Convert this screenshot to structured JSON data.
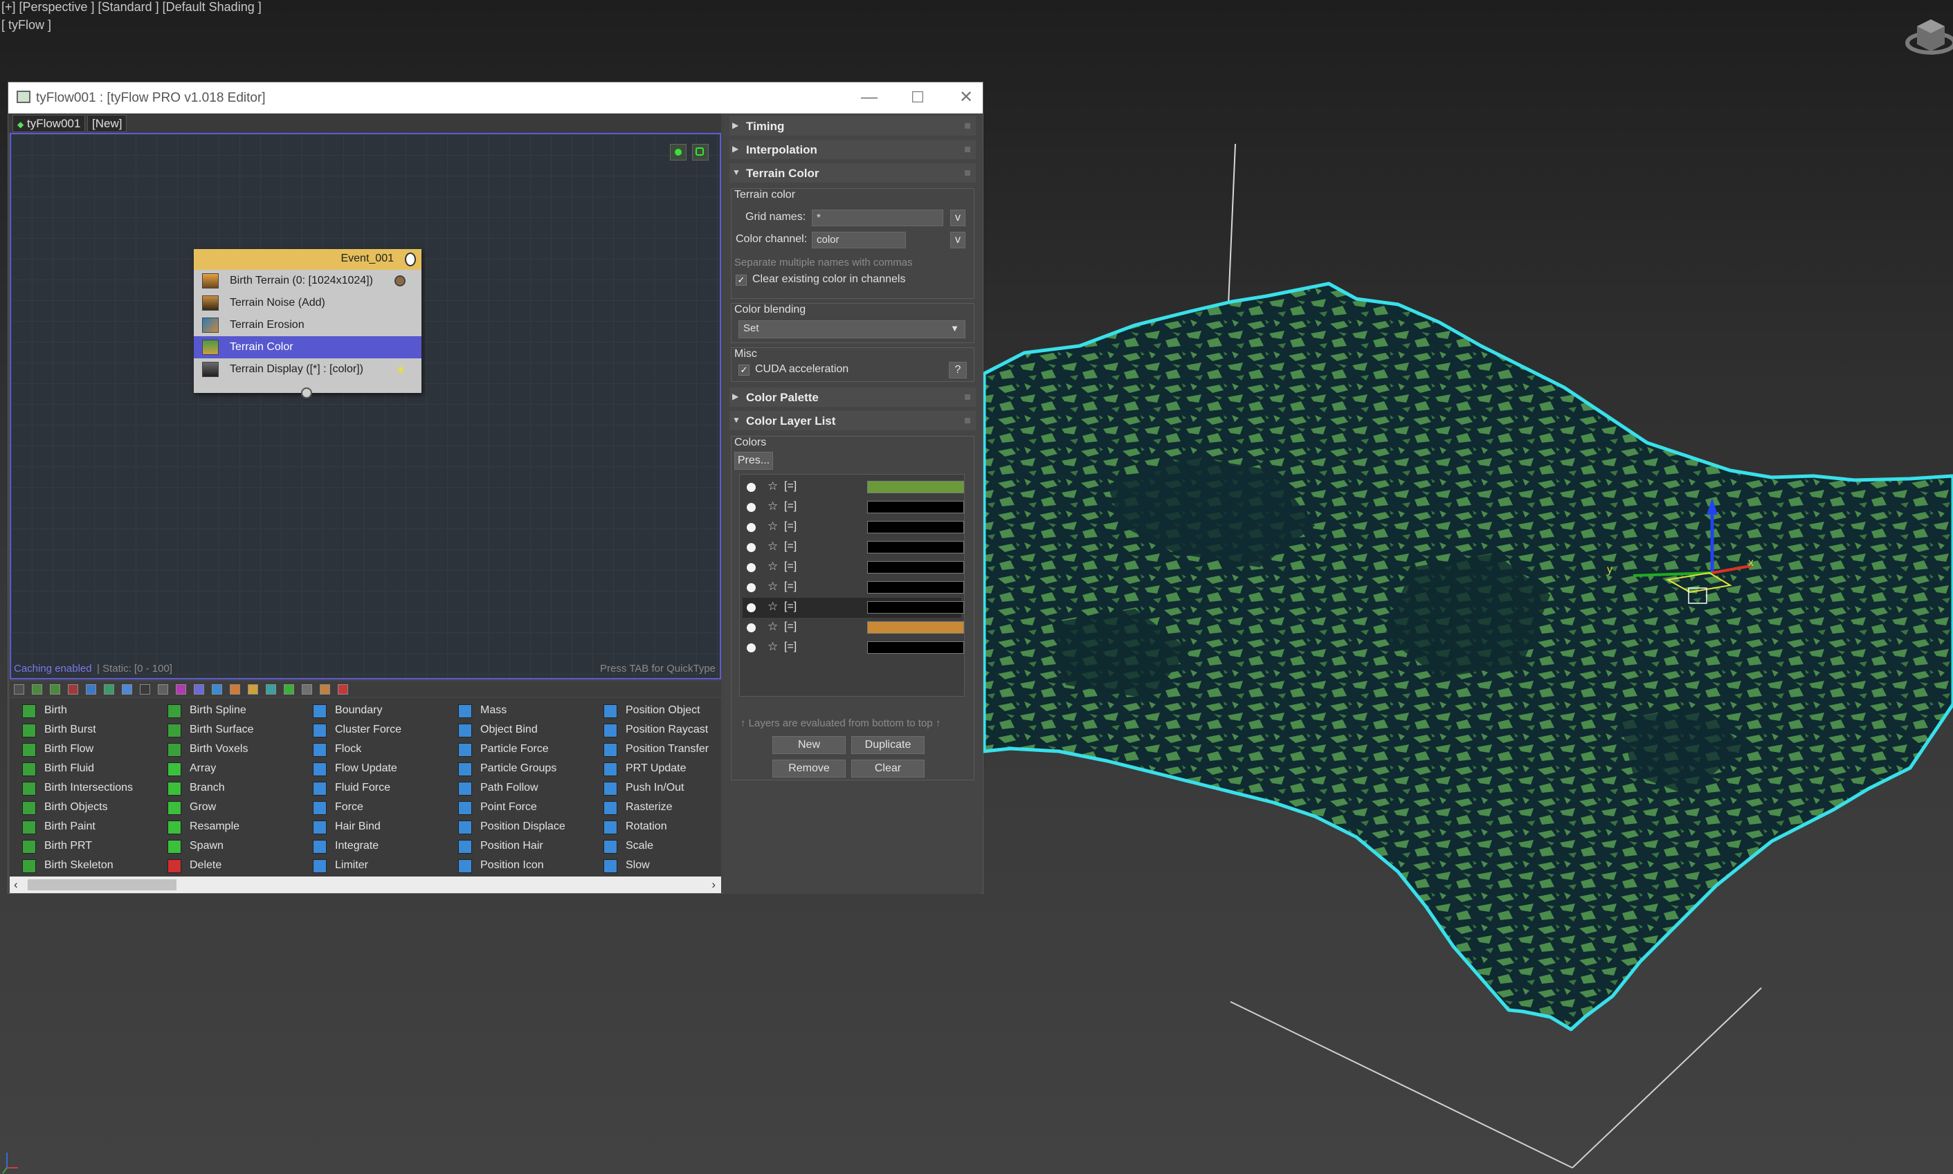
{
  "viewport": {
    "label_line1": "[+] [Perspective ] [Standard ] [Default Shading ]",
    "label_line2": "[ tyFlow ]"
  },
  "window": {
    "title": "tyFlow001 : [tyFlow PRO v1.018 Editor]",
    "controls": {
      "minimize": "—",
      "maximize": "☐",
      "close": "✕"
    },
    "tabs": [
      "tyFlow001",
      "[New]"
    ]
  },
  "graph": {
    "event": {
      "name": "Event_001",
      "operators": [
        {
          "label": "Birth Terrain (0: [1024x1024])",
          "selected": false
        },
        {
          "label": "Terrain Noise (Add)",
          "selected": false
        },
        {
          "label": "Terrain Erosion",
          "selected": false
        },
        {
          "label": "Terrain Color",
          "selected": true
        },
        {
          "label": "Terrain Display ([*] : [color])",
          "selected": false
        }
      ]
    },
    "status_left": "Caching enabled",
    "status_mid": "| Static: [0 - 100]",
    "status_right": "Press TAB for QuickType"
  },
  "operator_columns": [
    [
      "Birth",
      "Birth Burst",
      "Birth Flow",
      "Birth Fluid",
      "Birth Intersections",
      "Birth Objects",
      "Birth Paint",
      "Birth PRT",
      "Birth Skeleton"
    ],
    [
      "Birth Spline",
      "Birth Surface",
      "Birth Voxels",
      "Array",
      "Branch",
      "Grow",
      "Resample",
      "Spawn",
      "Delete"
    ],
    [
      "Boundary",
      "Cluster Force",
      "Flock",
      "Flow Update",
      "Fluid Force",
      "Force",
      "Hair Bind",
      "Integrate",
      "Limiter"
    ],
    [
      "Mass",
      "Object Bind",
      "Particle Force",
      "Particle Groups",
      "Path Follow",
      "Point Force",
      "Position Displace",
      "Position Hair",
      "Position Icon"
    ],
    [
      "Position Object",
      "Position Raycast",
      "Position Transfer",
      "PRT Update",
      "Push In/Out",
      "Rasterize",
      "Rotation",
      "Scale",
      "Slow"
    ]
  ],
  "rollouts": {
    "timing": "Timing",
    "interpolation": "Interpolation",
    "terrain_color": "Terrain Color",
    "color_palette": "Color Palette",
    "color_layer_list": "Color Layer List"
  },
  "terrain_color": {
    "group_title": "Terrain color",
    "grid_names_label": "Grid names:",
    "grid_names_value": "*",
    "color_channel_label": "Color channel:",
    "color_channel_value": "color",
    "v_button": "v",
    "hint": "Separate multiple names with commas",
    "clear_label": "Clear existing color in channels",
    "blending_title": "Color blending",
    "blending_value": "Set",
    "misc_title": "Misc",
    "cuda_label": "CUDA acceleration",
    "help_button": "?"
  },
  "color_layers": {
    "group_title": "Colors",
    "presets_button": "Pres...",
    "rows": [
      {
        "tag": "[=]",
        "color": "#6a9a3a"
      },
      {
        "tag": "[=]",
        "color": "#000000"
      },
      {
        "tag": "[=]",
        "color": "#000000"
      },
      {
        "tag": "[=]",
        "color": "#000000"
      },
      {
        "tag": "[=]",
        "color": "#000000"
      },
      {
        "tag": "[=]",
        "color": "#000000"
      },
      {
        "tag": "[=]",
        "color": "#000000"
      },
      {
        "tag": "[=]",
        "color": "#c88a35"
      },
      {
        "tag": "[=]",
        "color": "#000000"
      }
    ],
    "footer": "↑ Layers are evaluated from bottom to top ↑",
    "buttons": {
      "new": "New",
      "duplicate": "Duplicate",
      "remove": "Remove",
      "clear": "Clear"
    }
  },
  "gizmo": {
    "x_label": "x",
    "y_label": "y"
  },
  "colors": {
    "terrain_green": "#4a8a4a",
    "terrain_dark": "#0f2a30",
    "terrain_edge": "#39e0ea",
    "selection_blue": "#5757cf",
    "event_header": "#e6bf5c"
  }
}
